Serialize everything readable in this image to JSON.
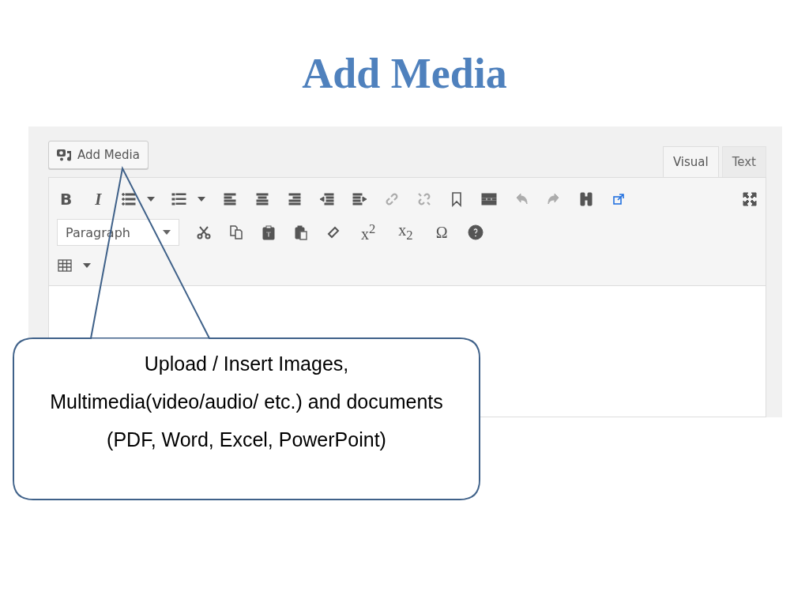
{
  "slide": {
    "title": "Add Media"
  },
  "editor": {
    "add_media": {
      "label": "Add Media"
    },
    "tabs": [
      {
        "label": "Visual",
        "selected": true
      },
      {
        "label": "Text",
        "selected": false
      }
    ],
    "toolbar_rows": [
      [
        {
          "kind": "bold",
          "label": "B",
          "disabled": false
        },
        {
          "kind": "italic",
          "label": "I",
          "disabled": false
        },
        {
          "kind": "bullets",
          "disabled": false
        },
        {
          "kind": "caret",
          "disabled": false
        },
        {
          "kind": "numbers",
          "disabled": false
        },
        {
          "kind": "caret",
          "disabled": false
        },
        {
          "kind": "alignleft",
          "disabled": false
        },
        {
          "kind": "aligncenter",
          "disabled": false
        },
        {
          "kind": "alignright",
          "disabled": false
        },
        {
          "kind": "outdent",
          "disabled": false
        },
        {
          "kind": "indent",
          "disabled": false
        },
        {
          "kind": "link",
          "disabled": true
        },
        {
          "kind": "unlink",
          "disabled": true
        },
        {
          "kind": "bookmark",
          "disabled": false
        },
        {
          "kind": "more",
          "disabled": false
        },
        {
          "kind": "undo",
          "disabled": true
        },
        {
          "kind": "redo",
          "disabled": true
        },
        {
          "kind": "find",
          "disabled": false
        },
        {
          "kind": "popout",
          "disabled": false
        },
        {
          "kind": "fullscreen",
          "disabled": false
        }
      ],
      [
        {
          "kind": "select",
          "label": "Paragraph",
          "disabled": false
        },
        {
          "kind": "cut",
          "disabled": false
        },
        {
          "kind": "copy",
          "disabled": false
        },
        {
          "kind": "pastetext",
          "disabled": false
        },
        {
          "kind": "pasteword",
          "disabled": false
        },
        {
          "kind": "eraser",
          "disabled": false
        },
        {
          "kind": "glyph",
          "label": "x$^{2}$",
          "disabled": false
        },
        {
          "kind": "glyph",
          "label": "x$_{2}$",
          "disabled": false
        },
        {
          "kind": "glyph",
          "label": "Ω",
          "disabled": false
        },
        {
          "kind": "help",
          "disabled": false
        }
      ],
      [
        {
          "kind": "table",
          "disabled": false
        },
        {
          "kind": "caret",
          "disabled": false
        }
      ]
    ]
  },
  "callout": {
    "text": "Upload / Insert Images, Multimedia(video/audio/ etc.) and documents (PDF, Word, Excel, PowerPoint)"
  }
}
